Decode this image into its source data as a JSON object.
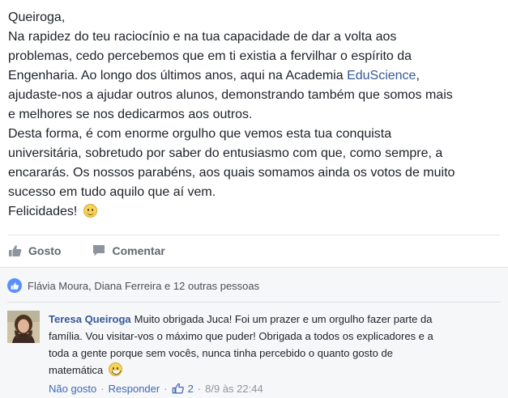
{
  "post": {
    "lines": [
      "Queiroga,",
      "Na rapidez do teu raciocínio e na tua capacidade de dar a volta aos",
      "problemas, cedo percebemos que em ti existia a fervilhar o espírito da",
      "Engenharia. Ao longo dos últimos anos, aqui na Academia ",
      "ajudaste-nos a ajudar outros alunos, demonstrando também que somos mais",
      "e melhores se nos dedicarmos aos outros.",
      "Desta forma, é com enorme orgulho que vemos esta tua conquista",
      "universitária, sobretudo por saber do entusiasmo com que, como sempre, a",
      "encararás. Os nossos parabéns, aos quais somamos ainda os votos de muito",
      "sucesso em tudo aquilo que aí vem.",
      "Felicidades! "
    ],
    "link_text": "EduScience",
    "link_suffix": ",",
    "emoji_icon": "smile-emoji-icon"
  },
  "actions": {
    "like_label": "Gosto",
    "comment_label": "Comentar"
  },
  "reactions": {
    "names": "Flávia Moura, Diana Ferreira e 12 outras pessoas",
    "icon": "thumbs-up-icon"
  },
  "comment": {
    "author": "Teresa Queiroga",
    "lines": [
      "Muito obrigada Juca! Foi um prazer e um orgulho fazer parte da",
      "família. Vou visitar-vos o máximo que puder! Obrigada a todos os explicadores e a",
      "toda a gente porque sem vocês, nunca tinha percebido o quanto gosto de",
      "matemática "
    ],
    "emoji_icon": "grin-emoji-icon",
    "unlike_label": "Não gosto",
    "reply_label": "Responder",
    "like_count": "2",
    "separator": "·",
    "timestamp": "8/9 às 22:44"
  },
  "colors": {
    "link": "#365899",
    "reaction_badge": "#5890ff",
    "action_text": "#616770",
    "feedback_bg": "#f6f7f9"
  }
}
